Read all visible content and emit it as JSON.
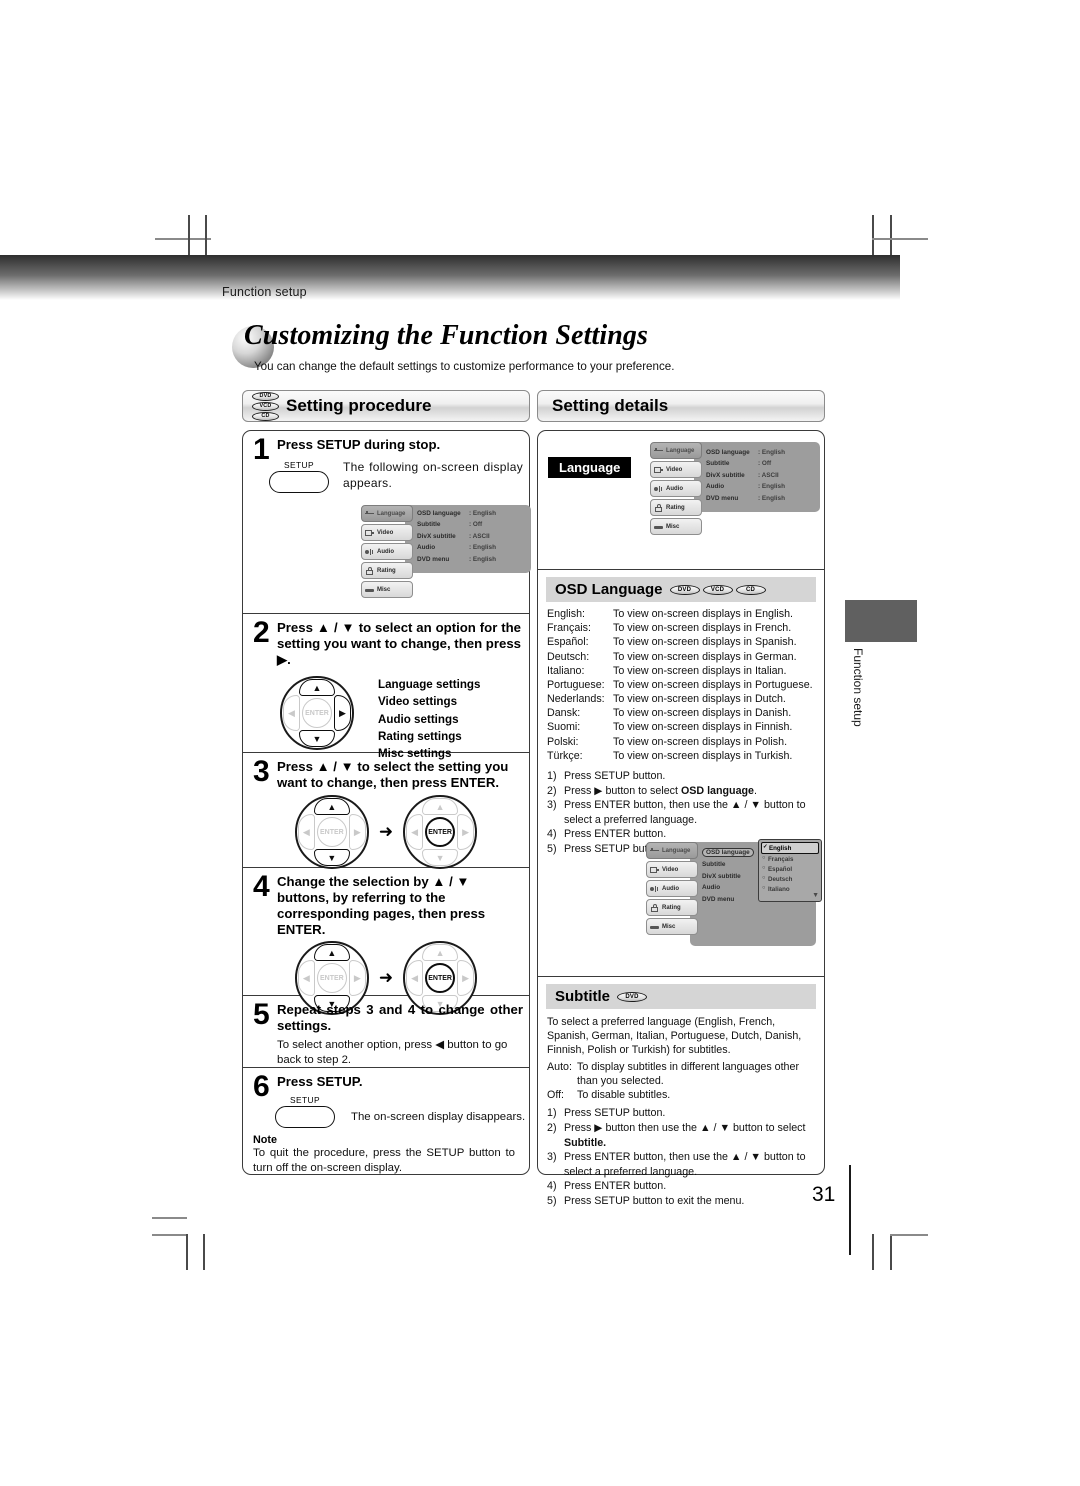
{
  "header": {
    "breadcrumb": "Function setup"
  },
  "title": {
    "heading": "Customizing the Function Settings",
    "subheading": "You can change the default settings to customize performance to your preference."
  },
  "sections": {
    "procedure_header": "Setting procedure",
    "details_header": "Setting details",
    "disc_badges": [
      "DVD",
      "VCD",
      "CD"
    ]
  },
  "steps": [
    {
      "num": "1",
      "title": "Press SETUP during stop.",
      "button_label": "SETUP",
      "body": "The following on-screen display appears."
    },
    {
      "num": "2",
      "title": "Press ▲ / ▼ to select an option for the setting you want to change, then press ▶.",
      "options": [
        "Language settings",
        "Video settings",
        "Audio settings",
        "Rating settings",
        "Misc settings"
      ]
    },
    {
      "num": "3",
      "title": "Press ▲ / ▼ to select the setting you want to change, then press ENTER."
    },
    {
      "num": "4",
      "title": "Change the selection by ▲ / ▼ buttons, by referring to the corresponding pages, then press ENTER."
    },
    {
      "num": "5",
      "title": "Repeat steps 3 and 4 to change other settings.",
      "body": "To select another option, press ◀ button to go back to step 2."
    },
    {
      "num": "6",
      "title": "Press SETUP.",
      "button_label": "SETUP",
      "body": "The on-screen display disappears."
    }
  ],
  "note": {
    "label": "Note",
    "text": "To quit the procedure, press the SETUP button to turn off the on-screen display."
  },
  "osd_menu": {
    "tabs": [
      "Language",
      "Video",
      "Audio",
      "Rating",
      "Misc"
    ],
    "active_tab": "Language",
    "rows": [
      {
        "key": "OSD language",
        "value": ": English"
      },
      {
        "key": "Subtitle",
        "value": ": Off"
      },
      {
        "key": "DivX subtitle",
        "value": ": ASCII"
      },
      {
        "key": "Audio",
        "value": ": English"
      },
      {
        "key": "DVD menu",
        "value": ": English"
      }
    ],
    "dropdown": {
      "field": "OSD language",
      "options": [
        "English",
        "Français",
        "Español",
        "Deutsch",
        "Italiano"
      ],
      "selected": "English",
      "scroll_indicator": "▼"
    }
  },
  "details": {
    "language_badge": "Language",
    "osd_language": {
      "heading": "OSD Language",
      "discs": [
        "DVD",
        "VCD",
        "CD"
      ],
      "languages": [
        {
          "name": "English:",
          "desc": "To view on-screen displays in English."
        },
        {
          "name": "Français:",
          "desc": "To view on-screen displays in French."
        },
        {
          "name": "Español:",
          "desc": "To view on-screen displays in Spanish."
        },
        {
          "name": "Deutsch:",
          "desc": "To view on-screen displays in German."
        },
        {
          "name": "Italiano:",
          "desc": "To view on-screen displays in Italian."
        },
        {
          "name": "Portuguese:",
          "desc": "To view on-screen displays in Portuguese."
        },
        {
          "name": "Nederlands:",
          "desc": "To view on-screen displays in Dutch."
        },
        {
          "name": "Dansk:",
          "desc": "To view on-screen displays in Danish."
        },
        {
          "name": "Suomi:",
          "desc": "To view on-screen displays in Finnish."
        },
        {
          "name": "Polski:",
          "desc": "To view on-screen displays in Polish."
        },
        {
          "name": "Türkçe:",
          "desc": "To view on-screen displays in Turkish."
        }
      ],
      "steps": [
        {
          "n": "1)",
          "text": "Press SETUP button."
        },
        {
          "n": "2)",
          "text": "Press ▶ button to select OSD language."
        },
        {
          "n": "3)",
          "text": "Press ENTER button, then use the ▲ / ▼ button to",
          "cont": "select a preferred language."
        },
        {
          "n": "4)",
          "text": "Press ENTER button."
        },
        {
          "n": "5)",
          "text": "Press SETUP button to exit the menu."
        }
      ]
    },
    "subtitle": {
      "heading": "Subtitle",
      "discs": [
        "DVD"
      ],
      "intro": "To select a preferred language (English, French, Spanish, German, Italian, Portuguese, Dutch, Danish, Finnish, Polish or Turkish) for subtitles.",
      "auto_label": "Auto:",
      "auto_text": "To display subtitles in different languages other than you selected.",
      "off_label": "Off:",
      "off_text": "To disable subtitles.",
      "steps": [
        {
          "n": "1)",
          "text": "Press SETUP button."
        },
        {
          "n": "2)",
          "text": "Press ▶ button then use the ▲ / ▼ button to select",
          "cont": "Subtitle."
        },
        {
          "n": "3)",
          "text": "Press ENTER button, then use the ▲ / ▼ button to",
          "cont": "select a preferred language."
        },
        {
          "n": "4)",
          "text": "Press ENTER button."
        },
        {
          "n": "5)",
          "text": "Press SETUP button to exit the menu."
        }
      ]
    }
  },
  "side_tab": {
    "text": "Function setup"
  },
  "page_number": "31",
  "dpad": {
    "enter_label": "ENTER",
    "up": "▲",
    "down": "▼",
    "left": "◀",
    "right": "▶",
    "arrow": "➜"
  }
}
